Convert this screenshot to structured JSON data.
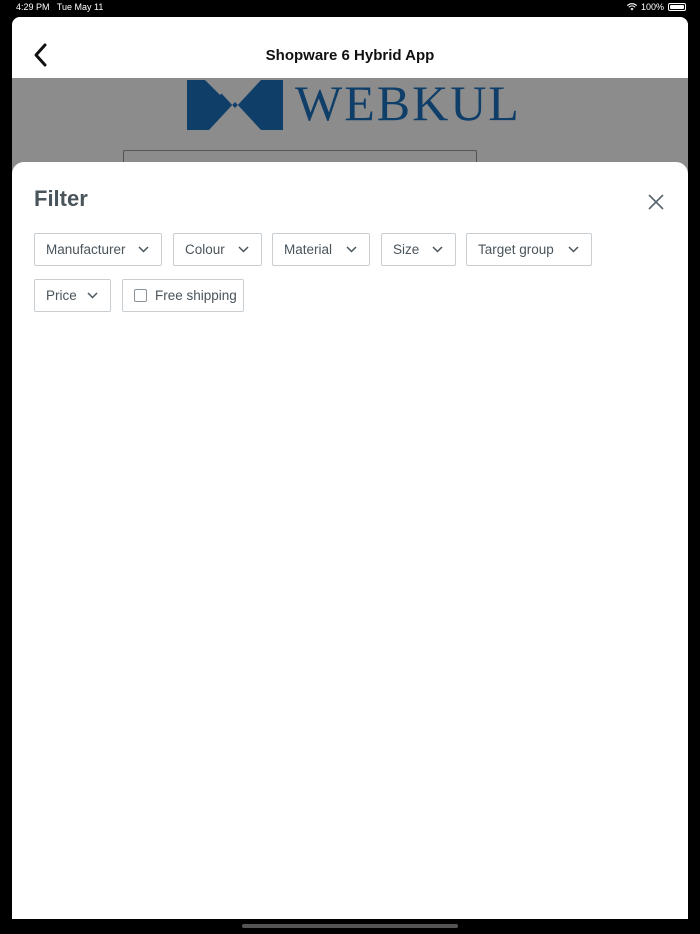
{
  "status_bar": {
    "time": "4:29 PM",
    "date": "Tue May 11",
    "battery": "100%"
  },
  "nav": {
    "title": "Shopware 6 Hybrid App"
  },
  "background": {
    "logo_text": "WEBKUL"
  },
  "filter": {
    "title": "Filter",
    "chips": {
      "manufacturer": "Manufacturer",
      "colour": "Colour",
      "material": "Material",
      "size": "Size",
      "target_group": "Target group",
      "price": "Price",
      "free_shipping": "Free shipping"
    },
    "free_shipping_checked": false
  },
  "colors": {
    "brand_blue": "#1d73c0",
    "text_gray": "#4a545b",
    "border_gray": "#c9ced3"
  }
}
